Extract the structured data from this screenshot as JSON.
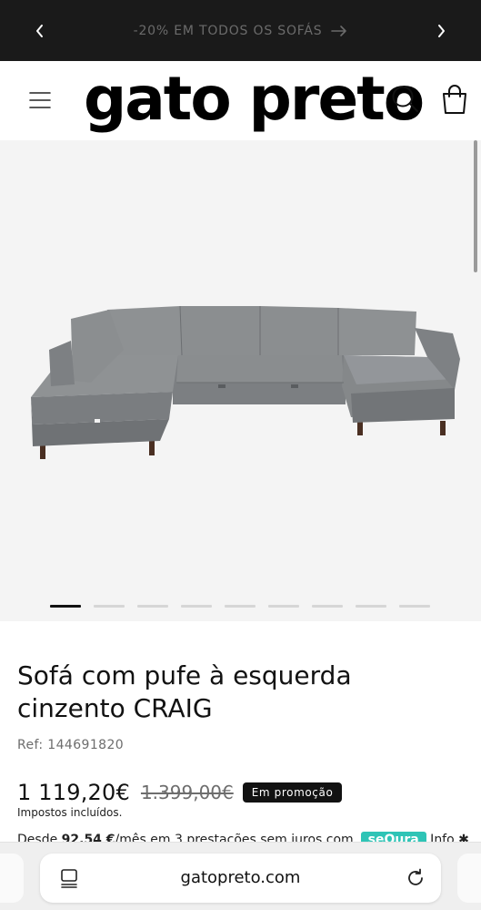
{
  "announcement": {
    "text": "-20% EM TODOS OS SOFÁS",
    "prev_icon": "chevron-left-icon",
    "next_icon": "chevron-right-icon",
    "arrow_icon": "arrow-right-icon"
  },
  "header": {
    "logo": "gato preto",
    "menu_icon": "hamburger-menu-icon",
    "search_icon": "search-icon",
    "cart_icon": "shopping-bag-icon"
  },
  "gallery": {
    "image_alt": "sofa-image",
    "slide_count": 9,
    "active_slide": 1
  },
  "product": {
    "title": "Sofá com pufe à esquerda cinzento CRAIG",
    "ref": "Ref: 144691820",
    "price": "1 119,20€",
    "old_price": "1.399,00€",
    "badge": "Em promoção",
    "tax_note": "Impostos incluídos.",
    "installments_prefix": "Desde ",
    "installments_amount": "92,54 €",
    "installments_suffix": "/mês em 3 prestações sem juros com",
    "installments_brand": "seQura",
    "installments_tail": " Info ✱"
  },
  "browser": {
    "url": "gatopreto.com",
    "tabs_icon": "tab-overview-icon",
    "reload_icon": "reload-icon"
  },
  "colors": {
    "announcement_bg": "#1a1a1a",
    "gallery_bg": "#f4f4f4",
    "badge_bg": "#121212",
    "sequra": "#2ec4b6"
  }
}
